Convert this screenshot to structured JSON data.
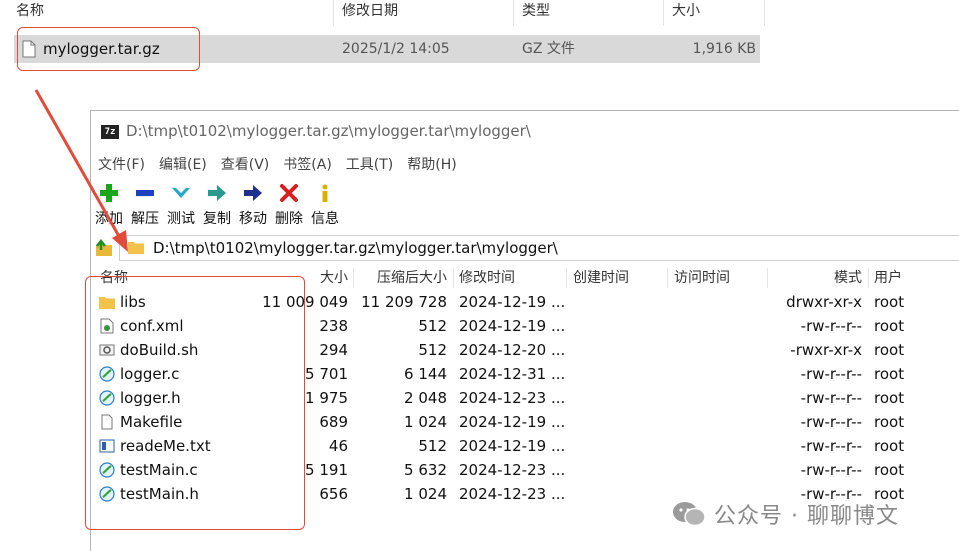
{
  "explorer": {
    "columns": [
      "名称",
      "修改日期",
      "类型",
      "大小"
    ],
    "file": {
      "name": "mylogger.tar.gz",
      "modified": "2025/1/2 14:05",
      "type": "GZ 文件",
      "size": "1,916 KB"
    }
  },
  "window": {
    "app_badge": "7z",
    "title": "D:\\tmp\\t0102\\mylogger.tar.gz\\mylogger.tar\\mylogger\\",
    "menu": [
      "文件(F)",
      "编辑(E)",
      "查看(V)",
      "书签(A)",
      "工具(T)",
      "帮助(H)"
    ],
    "toolbar": [
      {
        "label": "添加",
        "icon": "add-icon"
      },
      {
        "label": "解压",
        "icon": "extract-icon"
      },
      {
        "label": "测试",
        "icon": "test-icon"
      },
      {
        "label": "复制",
        "icon": "copy-icon"
      },
      {
        "label": "移动",
        "icon": "move-icon"
      },
      {
        "label": "删除",
        "icon": "delete-icon"
      },
      {
        "label": "信息",
        "icon": "info-icon"
      }
    ],
    "address": "D:\\tmp\\t0102\\mylogger.tar.gz\\mylogger.tar\\mylogger\\",
    "columns": [
      "名称",
      "大小",
      "压缩后大小",
      "修改时间",
      "创建时间",
      "访问时间",
      "模式",
      "用户"
    ],
    "files": [
      {
        "name": "libs",
        "icon": "folder",
        "size": "11 009 049",
        "packed": "11 209 728",
        "modified": "2024-12-19 ...",
        "mode": "drwxr-xr-x",
        "user": "root"
      },
      {
        "name": "conf.xml",
        "icon": "xml-file",
        "size": "238",
        "packed": "512",
        "modified": "2024-12-19 ...",
        "mode": "-rw-r--r--",
        "user": "root"
      },
      {
        "name": "doBuild.sh",
        "icon": "script-file",
        "size": "294",
        "packed": "512",
        "modified": "2024-12-20 ...",
        "mode": "-rwxr-xr-x",
        "user": "root"
      },
      {
        "name": "logger.c",
        "icon": "source-file",
        "size": "5 701",
        "packed": "6 144",
        "modified": "2024-12-31 ...",
        "mode": "-rw-r--r--",
        "user": "root"
      },
      {
        "name": "logger.h",
        "icon": "source-file",
        "size": "1 975",
        "packed": "2 048",
        "modified": "2024-12-23 ...",
        "mode": "-rw-r--r--",
        "user": "root"
      },
      {
        "name": "Makefile",
        "icon": "blank-file",
        "size": "689",
        "packed": "1 024",
        "modified": "2024-12-19 ...",
        "mode": "-rw-r--r--",
        "user": "root"
      },
      {
        "name": "readeMe.txt",
        "icon": "text-file",
        "size": "46",
        "packed": "512",
        "modified": "2024-12-19 ...",
        "mode": "-rw-r--r--",
        "user": "root"
      },
      {
        "name": "testMain.c",
        "icon": "source-file",
        "size": "5 191",
        "packed": "5 632",
        "modified": "2024-12-23 ...",
        "mode": "-rw-r--r--",
        "user": "root"
      },
      {
        "name": "testMain.h",
        "icon": "source-file",
        "size": "656",
        "packed": "1 024",
        "modified": "2024-12-23 ...",
        "mode": "-rw-r--r--",
        "user": "root"
      }
    ]
  },
  "watermark": "公众号 · 聊聊博文",
  "colors": {
    "annotation": "#e04b3b",
    "selection": "#d9d9d9"
  }
}
